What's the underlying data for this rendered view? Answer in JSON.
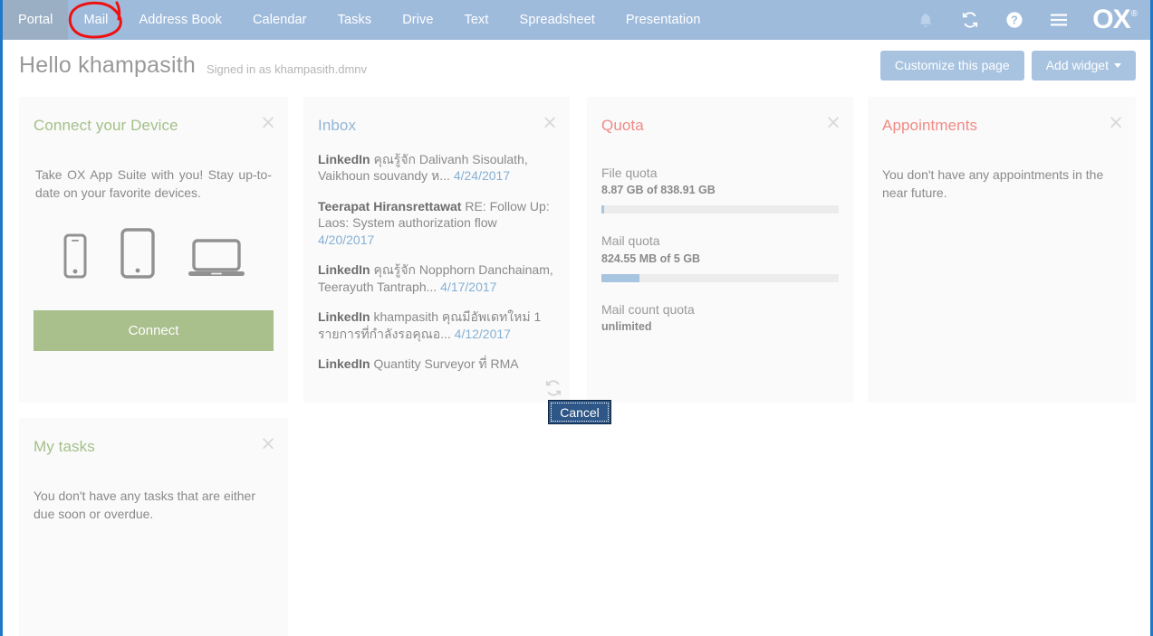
{
  "topbar": {
    "tabs": [
      {
        "label": "Portal",
        "active": true
      },
      {
        "label": "Mail",
        "active": false
      },
      {
        "label": "Address Book",
        "active": false
      },
      {
        "label": "Calendar",
        "active": false
      },
      {
        "label": "Tasks",
        "active": false
      },
      {
        "label": "Drive",
        "active": false
      },
      {
        "label": "Text",
        "active": false
      },
      {
        "label": "Spreadsheet",
        "active": false
      },
      {
        "label": "Presentation",
        "active": false
      }
    ],
    "icons": [
      "bell-icon",
      "refresh-icon",
      "help-icon",
      "menu-icon"
    ],
    "logo": "OX",
    "logo_mark": "®",
    "bar_color": "#9fbbdc",
    "active_tab_color": "#9bafc4",
    "annotation": {
      "shape": "red-circle",
      "target": "Mail",
      "color": "#ee1111"
    }
  },
  "greeting": {
    "hello": "Hello khampasith",
    "signed_in_as": "Signed in as khampasith.dmnv",
    "customize_label": "Customize this page",
    "add_widget_label": "Add widget",
    "button_color": "#a8c3e0"
  },
  "widgets": {
    "connect": {
      "title": "Connect your Device",
      "title_color": "#a4c08a",
      "description": "Take OX App Suite with you! Stay up-to-date on your favorite devices.",
      "devices": [
        "smartphone-icon",
        "tablet-icon",
        "laptop-icon"
      ],
      "button_label": "Connect",
      "button_color": "#a9bf8c",
      "close_label": "×"
    },
    "inbox": {
      "title": "Inbox",
      "title_color": "#93b6d6",
      "close_label": "×",
      "mails": [
        {
          "from": "LinkedIn",
          "subject": "คุณรู้จัก Dalivanh Sisoulath, Vaikhoun souvandy ห...",
          "date": "4/24/2017"
        },
        {
          "from": "Teerapat Hiransrettawat",
          "subject": "RE: Follow Up: Laos: System authorization flow",
          "date": "4/20/2017"
        },
        {
          "from": "LinkedIn",
          "subject": "คุณรู้จัก Nopphorn Danchainam, Teerayuth Tantraph...",
          "date": "4/17/2017"
        },
        {
          "from": "LinkedIn",
          "subject": "khampasith คุณมีอัพเดทใหม่ 1 รายการที่กำลังรอคุณอ...",
          "date": "4/12/2017"
        },
        {
          "from": "LinkedIn",
          "subject": "Quantity Surveyor ที่ RMA",
          "date": ""
        }
      ]
    },
    "quota": {
      "title": "Quota",
      "title_color": "#f08a85",
      "close_label": "×",
      "items": [
        {
          "label": "File quota",
          "value": "8.87 GB of 838.91 GB",
          "percent": 1.1,
          "has_bar": true
        },
        {
          "label": "Mail quota",
          "value": "824.55 MB of 5 GB",
          "percent": 16.1,
          "has_bar": true
        },
        {
          "label": "Mail count quota",
          "value": "unlimited",
          "percent": 0,
          "has_bar": false
        }
      ],
      "bar_fill_color": "#a7c4e0",
      "bar_track_color": "#ececec"
    },
    "appointments": {
      "title": "Appointments",
      "title_color": "#f08a85",
      "close_label": "×",
      "empty_message": "You don't have any appointments in the near future."
    },
    "tasks": {
      "title": "My tasks",
      "title_color": "#a4c08a",
      "close_label": "×",
      "empty_message": "You don't have any tasks that are either due soon or overdue."
    }
  },
  "overlay": {
    "cancel_label": "Cancel",
    "cancel_bg": "#2e5686"
  }
}
